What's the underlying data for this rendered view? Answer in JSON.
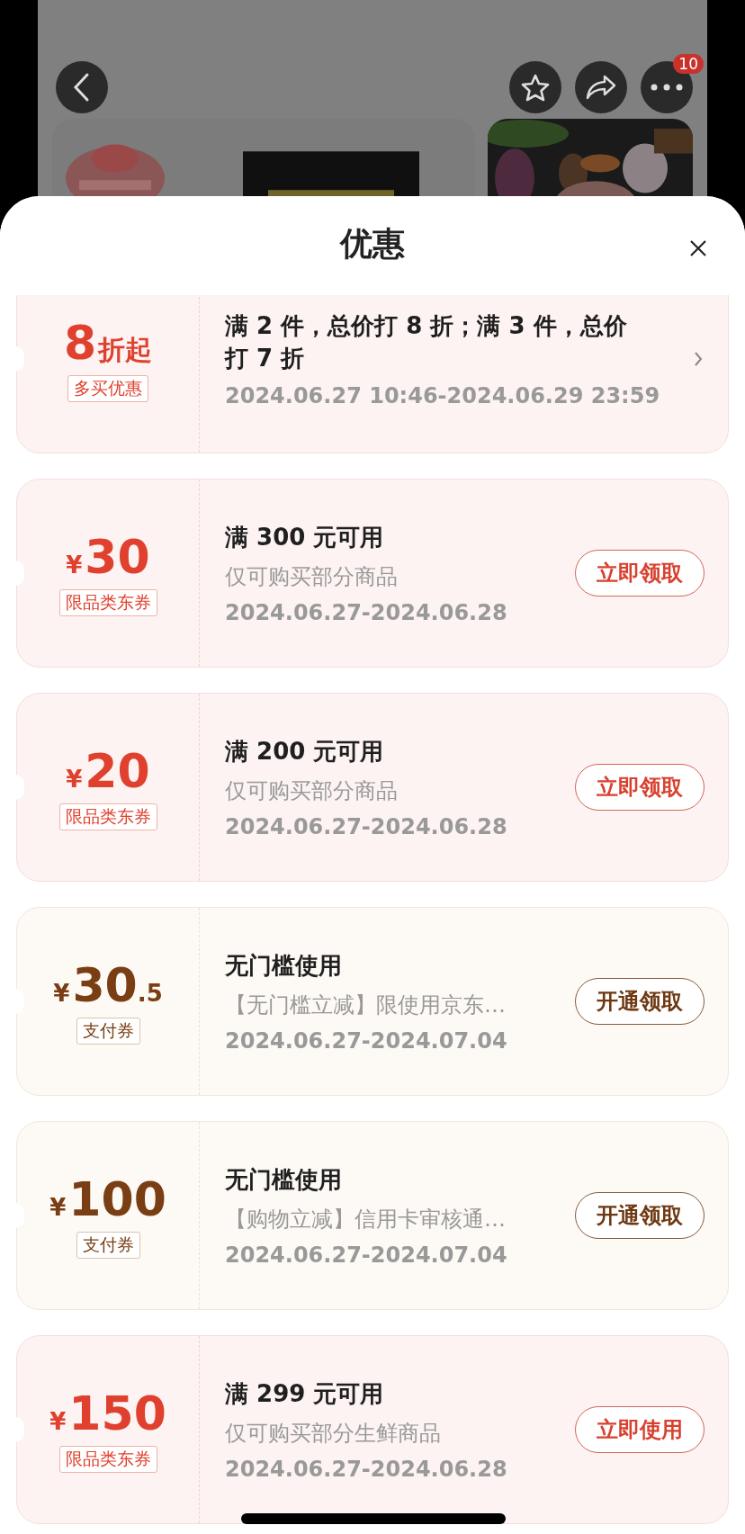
{
  "background_page": {
    "more_badge": "10"
  },
  "sheet": {
    "title": "优惠"
  },
  "coupons": [
    {
      "kind": "multi_buy",
      "amount": {
        "value": "8",
        "unit": "折起"
      },
      "tag": "多买优惠",
      "title": "满 2 件，总价打 8 折；满 3 件，总价打 7 折",
      "dates": "2024.06.27 10:46-2024.06.29 23:59"
    },
    {
      "kind": "category",
      "amount": {
        "currency": "¥",
        "value": "30"
      },
      "tag": "限品类东券",
      "title": "满 300 元可用",
      "note": "仅可购买部分商品",
      "dates": "2024.06.27-2024.06.28",
      "action": "立即领取"
    },
    {
      "kind": "category",
      "amount": {
        "currency": "¥",
        "value": "20"
      },
      "tag": "限品类东券",
      "title": "满 200 元可用",
      "note": "仅可购买部分商品",
      "dates": "2024.06.27-2024.06.28",
      "action": "立即领取"
    },
    {
      "kind": "payment",
      "amount": {
        "currency": "¥",
        "value": "30",
        "decimal": ".5"
      },
      "tag": "支付券",
      "title": "无门槛使用",
      "note": "【无门槛立减】限使用京东…",
      "dates": "2024.06.27-2024.07.04",
      "action": "开通领取"
    },
    {
      "kind": "payment",
      "amount": {
        "currency": "¥",
        "value": "100"
      },
      "tag": "支付券",
      "title": "无门槛使用",
      "note": "【购物立减】信用卡审核通…",
      "dates": "2024.06.27-2024.07.04",
      "action": "开通领取"
    },
    {
      "kind": "category",
      "amount": {
        "currency": "¥",
        "value": "150"
      },
      "tag": "限品类东券",
      "title": "满 299 元可用",
      "note": "仅可购买部分生鲜商品",
      "dates": "2024.06.27-2024.06.28",
      "action": "立即使用"
    }
  ]
}
